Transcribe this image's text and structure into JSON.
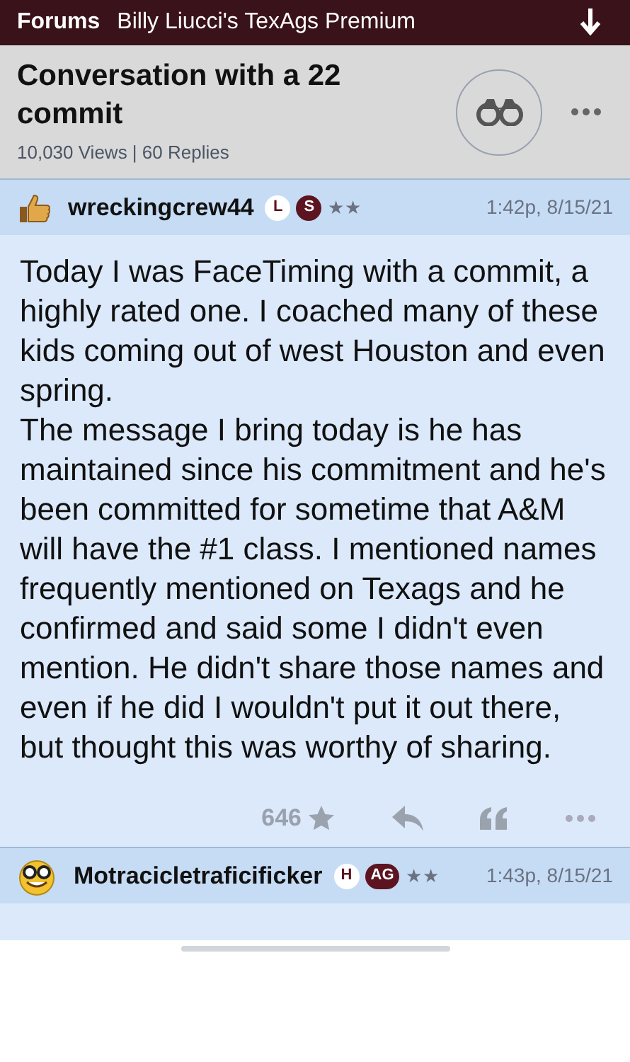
{
  "top_bar": {
    "section": "Forums",
    "forum": "Billy Liucci's TexAgs Premium"
  },
  "thread": {
    "title": "Conversation with a 22 commit",
    "stats": "10,030 Views | 60 Replies"
  },
  "posts": [
    {
      "kind": "thumbs",
      "author": "wreckingcrew44",
      "badges": [
        {
          "label": "L",
          "kind": "light"
        },
        {
          "label": "S",
          "kind": "dark"
        }
      ],
      "stars": "★★",
      "time": "1:42p, 8/15/21",
      "paragraphs": [
        "Today I was FaceTiming with a commit, a highly rated one. I coached many of these kids coming out of west Houston and even spring.",
        "The message I bring today is he has maintained since his commitment and he's been committed for sometime that A&M will have the #1 class. I mentioned names frequently mentioned on Texags and he confirmed and said some I didn't even mention. He didn't share those names and even if he did I wouldn't put it out there, but thought this was worthy of sharing."
      ],
      "likes": "646"
    },
    {
      "kind": "smiley",
      "author": "Motracicletraficificker",
      "badges": [
        {
          "label": "H",
          "kind": "light"
        },
        {
          "label": "AG",
          "kind": "dark"
        }
      ],
      "stars": "★★",
      "time": "1:43p, 8/15/21"
    }
  ]
}
